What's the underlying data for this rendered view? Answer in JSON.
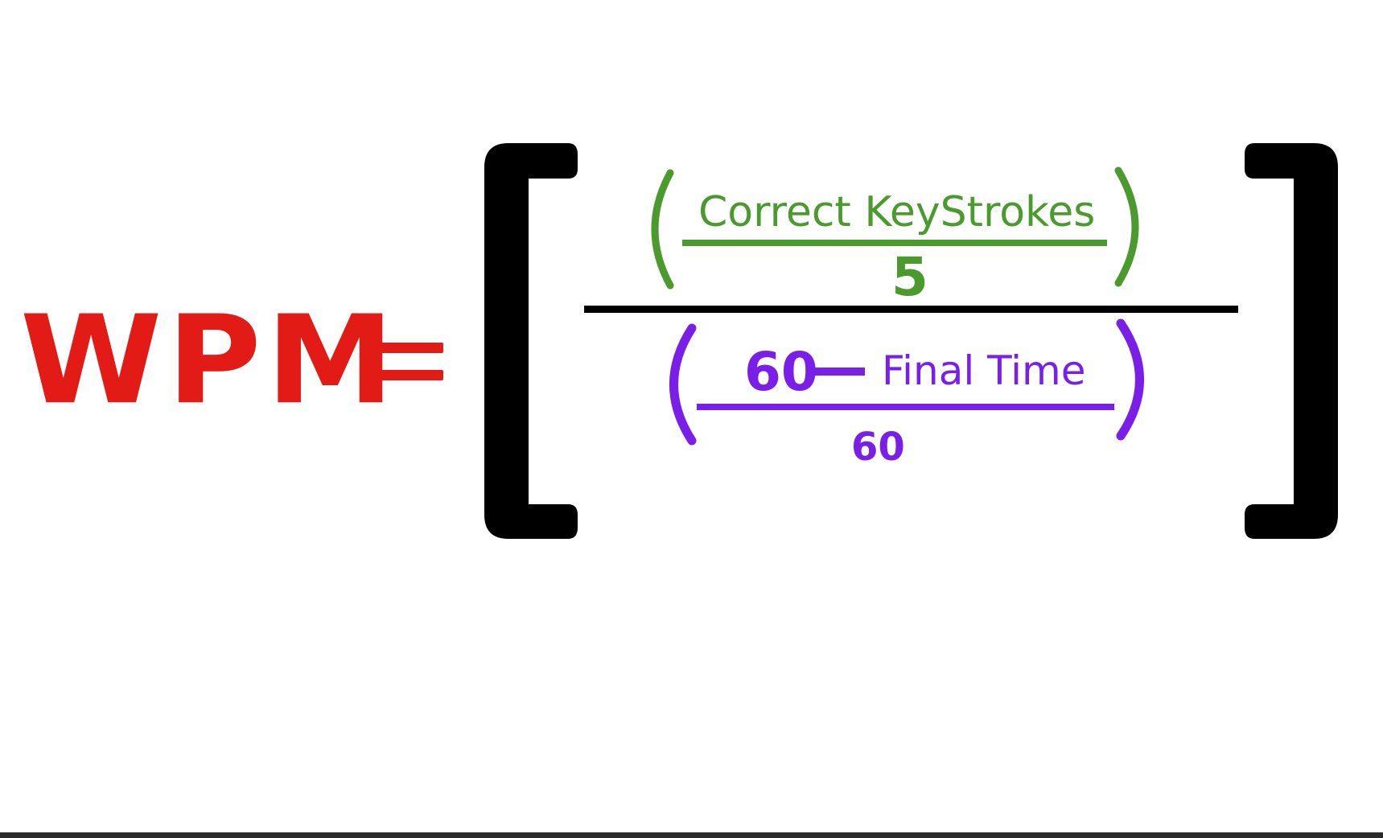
{
  "formula": {
    "lhs": "WPM",
    "numerator": {
      "text": "Correct KeyStrokes",
      "denominator": "5"
    },
    "denominator": {
      "minuend": "60",
      "subtrahend": "Final Time",
      "denominator": "60"
    }
  },
  "colors": {
    "lhs": "#e31b17",
    "numerator": "#4a9a2e",
    "denominator": "#7a1fe8",
    "brackets": "#000000",
    "background": "#ffffff"
  }
}
